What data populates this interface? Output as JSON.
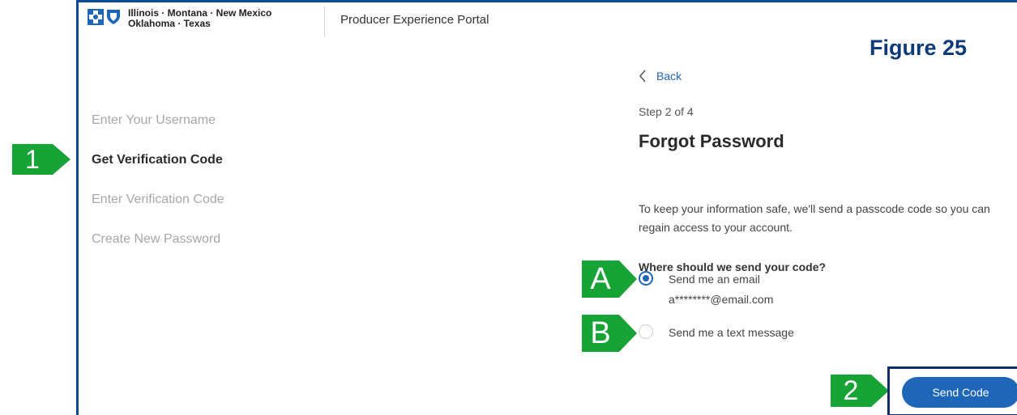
{
  "header": {
    "brand_line1": "Illinois · Montana · New Mexico",
    "brand_line2": "Oklahoma · Texas",
    "portal_title": "Producer Experience Portal",
    "brand_color": "#1e66b8"
  },
  "annotation": {
    "figure_label": "Figure 25",
    "callouts": {
      "c1": "1",
      "c2": "2",
      "cA": "A",
      "cB": "B"
    },
    "callout_color": "#17a336"
  },
  "steps": [
    {
      "label": "Enter Your Username",
      "active": false
    },
    {
      "label": "Get Verification Code",
      "active": true
    },
    {
      "label": "Enter Verification Code",
      "active": false
    },
    {
      "label": "Create New Password",
      "active": false
    }
  ],
  "form": {
    "back_label": "Back",
    "step_count": "Step 2 of 4",
    "title": "Forgot Password",
    "description": "To keep your information safe, we'll send a passcode code so you can regain access to your account.",
    "question": "Where should we send your code?",
    "options": [
      {
        "label": "Send me an email",
        "detail": "a********@email.com",
        "selected": true
      },
      {
        "label": "Send me a text message",
        "detail": "",
        "selected": false
      }
    ],
    "submit_label": "Send Code"
  }
}
